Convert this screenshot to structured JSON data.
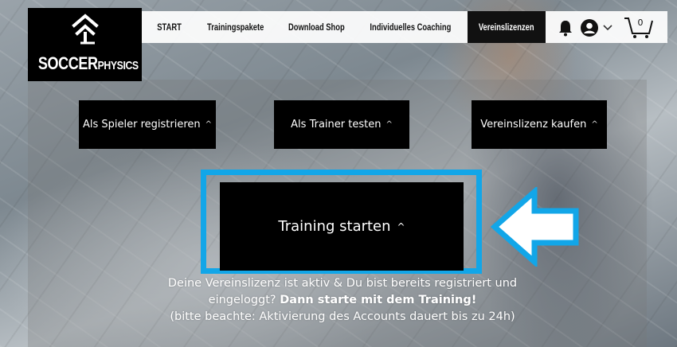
{
  "logo": {
    "text_main": "SOCCER",
    "text_sub": "PHYSICS",
    "icon": "chevron-up-house-icon"
  },
  "nav": {
    "items": [
      {
        "label": "START"
      },
      {
        "label": "Trainingspakete"
      },
      {
        "label": "Download Shop"
      },
      {
        "label": "Individuelles Coaching"
      },
      {
        "label": "Vereinslizenzen",
        "active": true
      }
    ],
    "cart_count": "0",
    "icons": [
      "bell-icon",
      "user-icon",
      "chevron-down-icon",
      "cart-icon"
    ]
  },
  "buttons": {
    "player": {
      "label": "Als Spieler registrieren",
      "caret": "^"
    },
    "trainer": {
      "label": "Als Trainer testen",
      "caret": "^"
    },
    "license": {
      "label": "Vereinslizenz kaufen",
      "caret": "^"
    },
    "start": {
      "label": "Training starten",
      "caret": "^"
    }
  },
  "info": {
    "line1": "Deine Vereinslizenz ist aktiv & Du bist bereits registriert und",
    "line2_plain": "eingeloggt? ",
    "line2_bold": "Dann starte mit dem Training!",
    "line3": "(bitte beachte: Aktivierung des Accounts dauert bis zu 24h)"
  },
  "colors": {
    "highlight": "#12a6e8",
    "button_bg": "#000000",
    "nav_active_bg": "#111111"
  }
}
